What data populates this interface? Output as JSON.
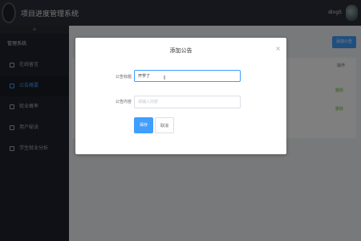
{
  "header": {
    "title": "项目进度管理系统",
    "username": "ding5"
  },
  "sidebar": {
    "collapse": "≡",
    "group": "管理系统",
    "items": [
      {
        "label": "在线留言",
        "icon": "message-icon",
        "active": false
      },
      {
        "label": "公告概要",
        "icon": "notice-icon",
        "active": true
      },
      {
        "label": "就业概率",
        "icon": "edit-icon",
        "active": false
      },
      {
        "label": "用户秘诀",
        "icon": "user-icon",
        "active": false
      },
      {
        "label": "学生就业分析",
        "icon": "analysis-icon",
        "active": false
      }
    ]
  },
  "main": {
    "add_button": "添加公告",
    "table": {
      "ops_header": "操作",
      "rows": [
        {
          "text": "行",
          "edit": "删除"
        },
        {
          "text": "行",
          "edit": "删除"
        }
      ]
    }
  },
  "dialog": {
    "title": "添加公告",
    "close": "×",
    "title_label": "公告标题",
    "title_value": "开学了",
    "content_label": "公告内容",
    "content_placeholder": "请输入内容",
    "save": "保存",
    "cancel": "取消"
  },
  "colors": {
    "primary": "#409eff",
    "header_bg": "#2b2f3a",
    "sidebar_bg": "#1f232c",
    "overlay": "rgba(0,0,0,0.5)"
  }
}
